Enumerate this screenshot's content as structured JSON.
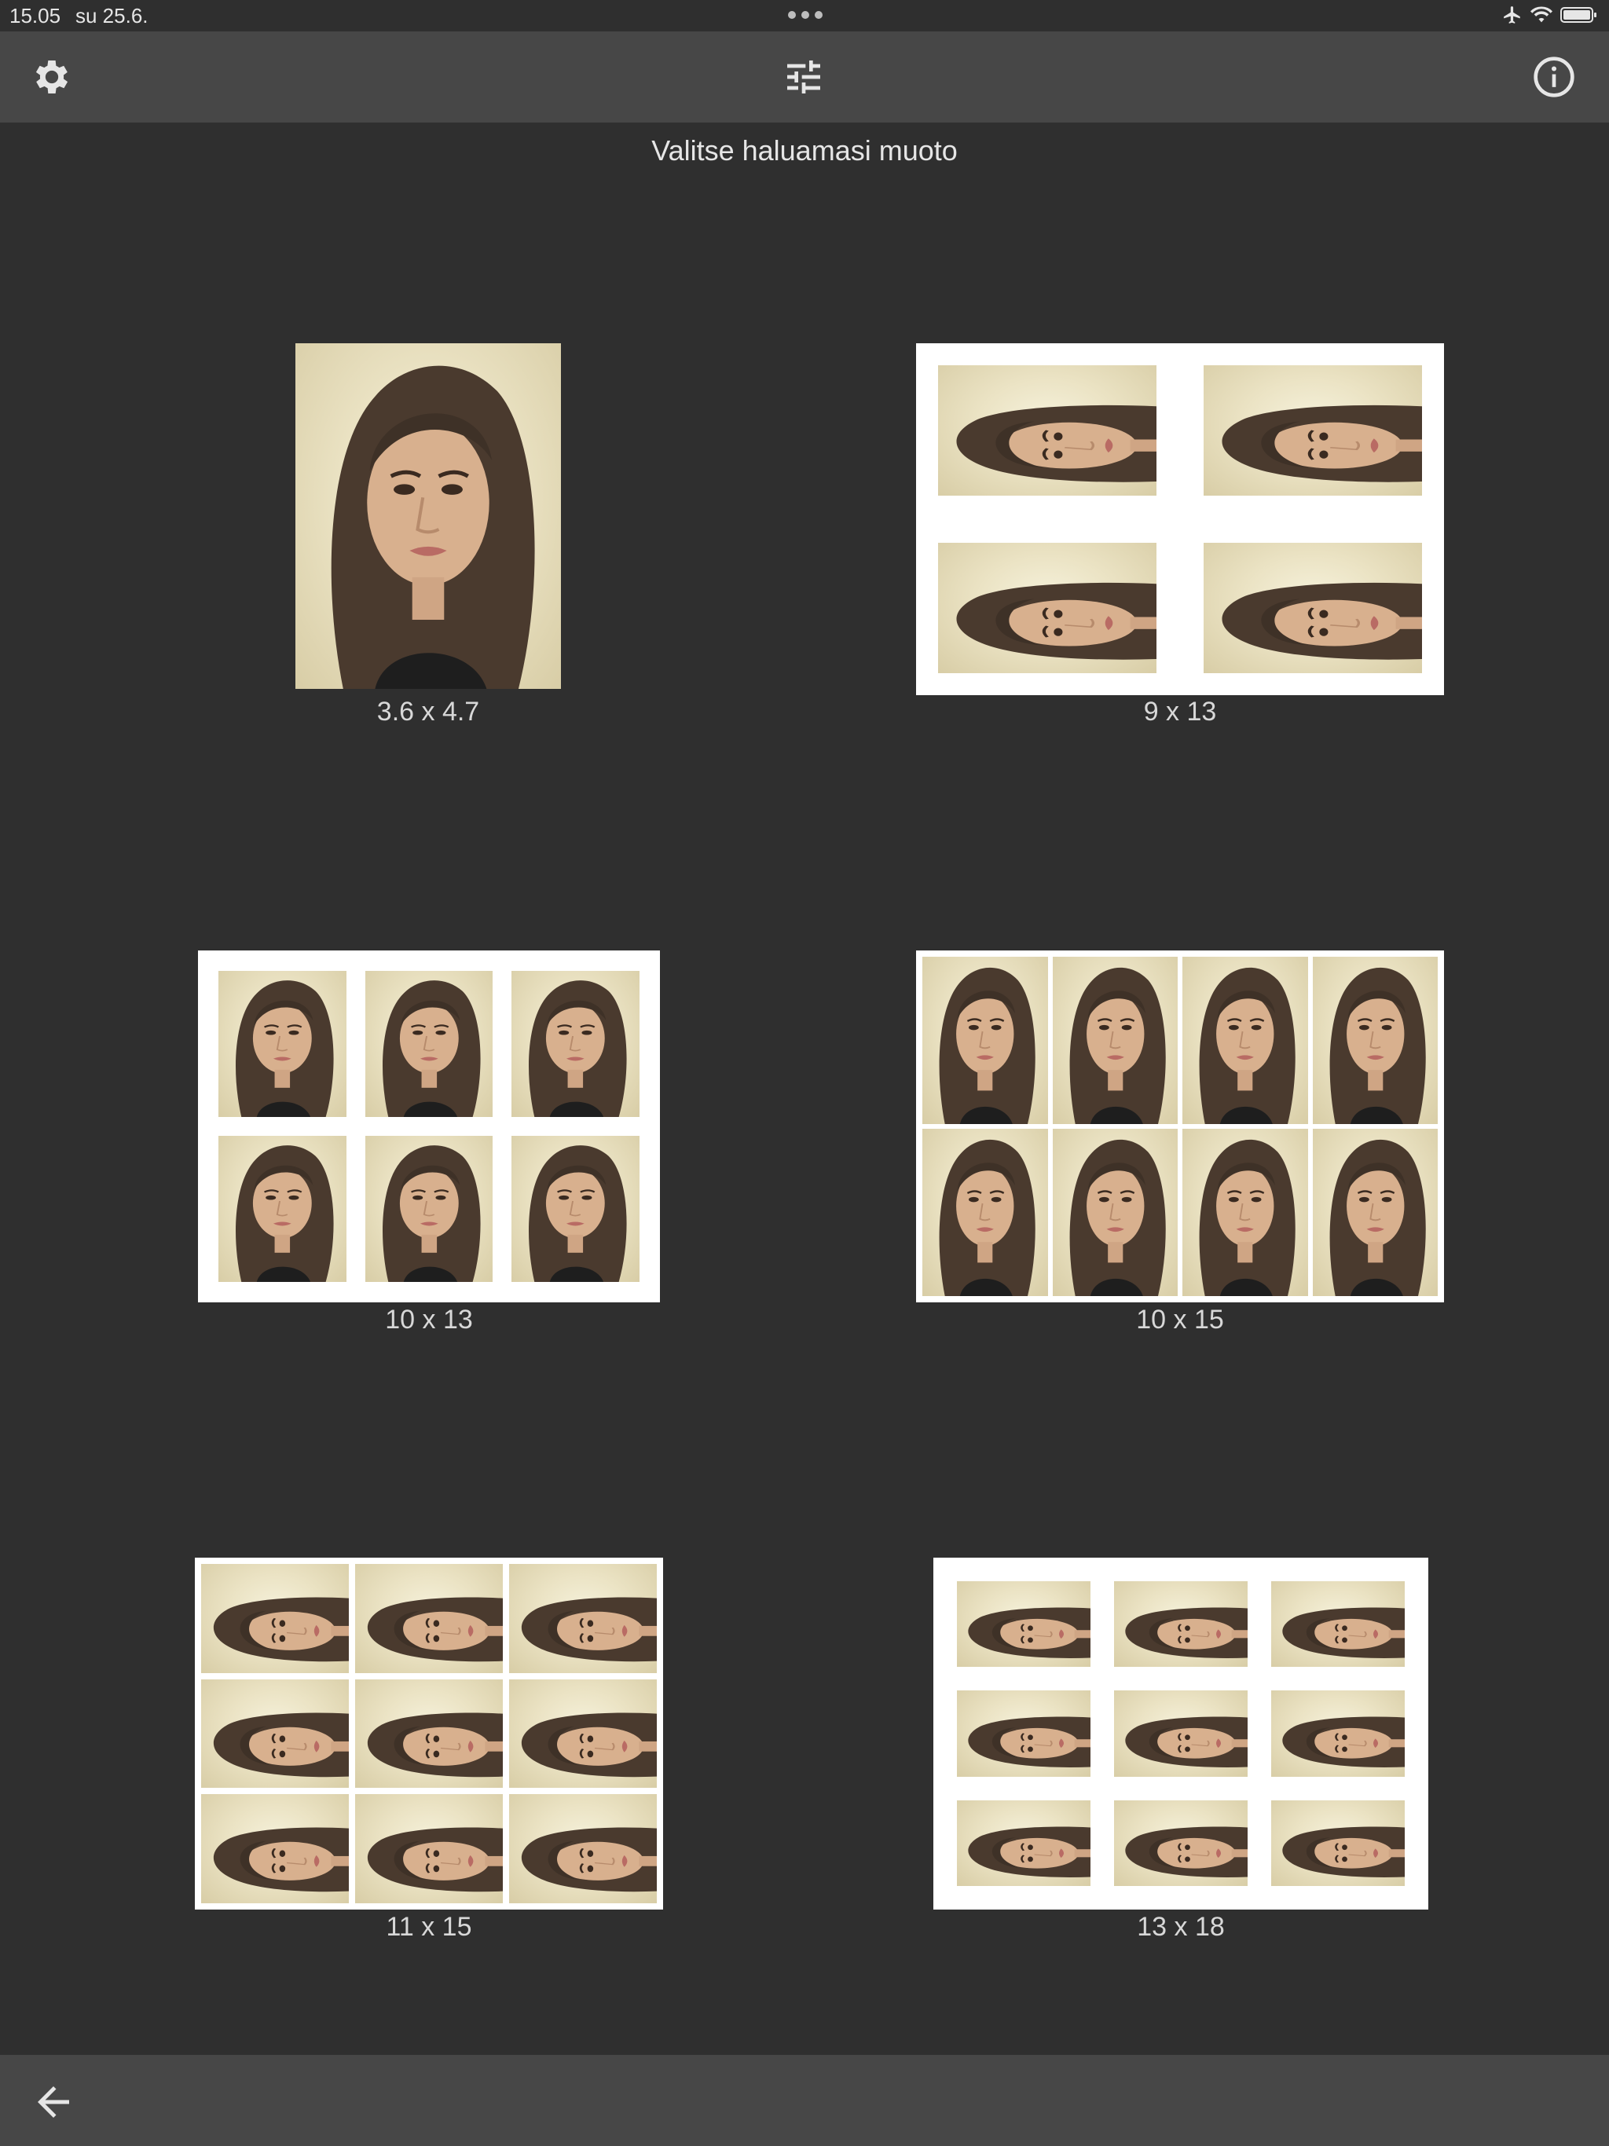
{
  "status": {
    "time": "15.05",
    "date": "su 25.6."
  },
  "toolbar": {
    "settings_icon": "gear-icon",
    "adjust_icon": "sliders-icon",
    "info_icon": "info-icon"
  },
  "prompt": "Valitse haluamasi muoto",
  "formats": [
    {
      "label": "3.6 x 4.7",
      "cols": 1,
      "rows": 1,
      "orientation": "portrait"
    },
    {
      "label": "9 x 13",
      "cols": 2,
      "rows": 2,
      "orientation": "rotated"
    },
    {
      "label": "10 x 13",
      "cols": 3,
      "rows": 2,
      "orientation": "portrait"
    },
    {
      "label": "10 x 15",
      "cols": 4,
      "rows": 2,
      "orientation": "portrait"
    },
    {
      "label": "11 x 15",
      "cols": 3,
      "rows": 3,
      "orientation": "rotated"
    },
    {
      "label": "13 x 18",
      "cols": 3,
      "rows": 3,
      "orientation": "rotated"
    }
  ],
  "bottombar": {
    "back_icon": "arrow-left-icon"
  },
  "colors": {
    "background": "#2f2f2f",
    "bar": "#474747",
    "text": "#e6e6e6"
  }
}
